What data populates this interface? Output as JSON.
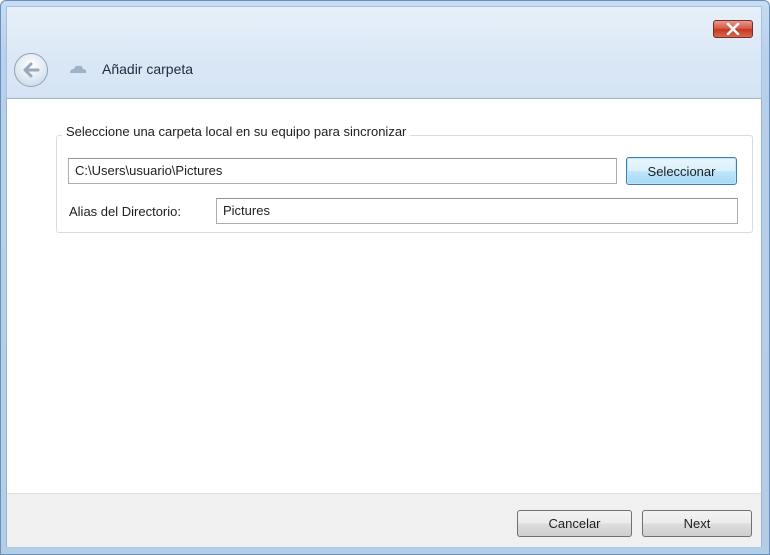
{
  "window": {
    "title": "Añadir carpeta",
    "close_icon": "close-icon",
    "back_icon": "back-arrow-icon"
  },
  "group": {
    "legend": "Seleccione una carpeta local en su equipo para sincronizar",
    "path_value": "C:\\Users\\usuario\\Pictures",
    "select_button": "Seleccionar",
    "alias_label": "Alias del Directorio:",
    "alias_value": "Pictures"
  },
  "footer": {
    "cancel_button": "Cancelar",
    "next_button": "Next"
  },
  "colors": {
    "frame": "#b7d0ec",
    "close_button": "#c9452d",
    "selected_button": "#bee6fd"
  }
}
